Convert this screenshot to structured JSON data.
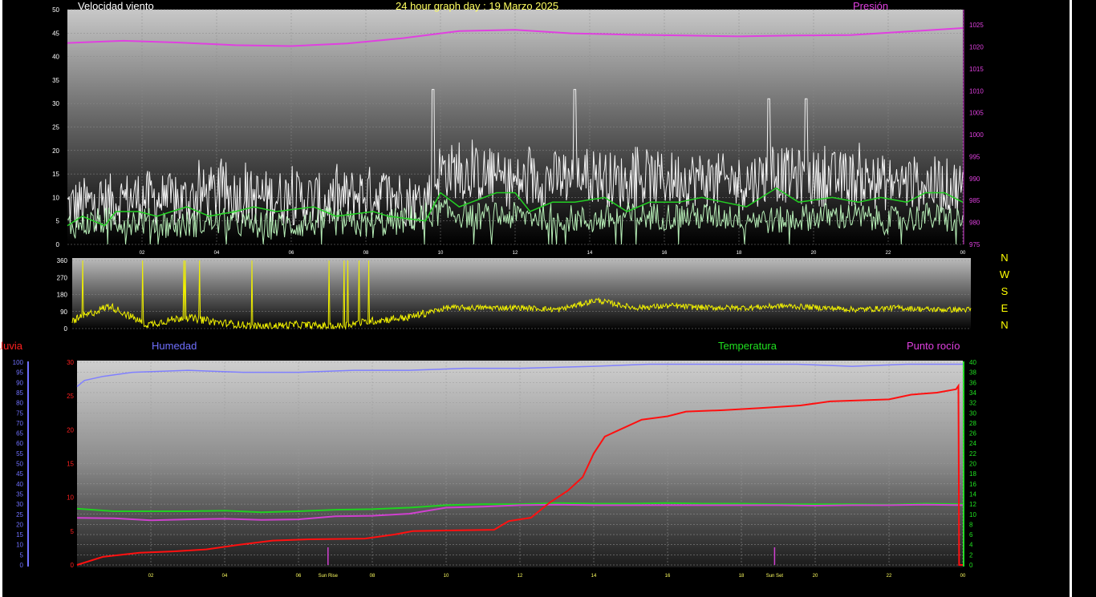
{
  "title": "24 hour graph day : 19 Marzo 2025",
  "colors": {
    "wind": "#f2f2f2",
    "wind_avg": "#b8f0b8",
    "wind_green": "#22d022",
    "pressure": "#e040e0",
    "direction": "#f0f000",
    "humidity": "#8080ff",
    "rain": "#ff1010",
    "temperature": "#20d020",
    "dew": "#d040d0",
    "rain_label": "#ff2020",
    "humidity_label": "#7070ff",
    "temperature_label": "#20e020",
    "dew_label": "#e040e0",
    "pressure_label": "#e040e0",
    "wind_label": "#ffffff",
    "title": "#ffff60"
  },
  "chart_data": [
    {
      "type": "line",
      "id": "wind-pressure",
      "title": "",
      "series_labels": {
        "wind": "Velocidad viento",
        "pressure": "Presión"
      },
      "x_ticks": [
        "02",
        "04",
        "06",
        "08",
        "",
        "10",
        "12",
        "14",
        "16",
        "18",
        "20",
        "22",
        "00"
      ],
      "x_range": [
        0,
        24
      ],
      "y_left": {
        "range": [
          0,
          50
        ],
        "ticks": [
          0,
          5,
          10,
          15,
          20,
          25,
          30,
          35,
          40,
          45,
          50
        ]
      },
      "y_right": {
        "range": [
          975,
          1028.5
        ],
        "ticks": [
          975,
          980,
          985,
          990,
          995,
          1000,
          1005,
          1010,
          1015,
          1020,
          1025
        ]
      },
      "grid": true,
      "series": [
        {
          "key": "pressure",
          "axis": "right",
          "x": [
            0,
            1.5,
            3,
            4.5,
            6,
            7.5,
            9,
            10.5,
            12,
            13.5,
            15,
            16.5,
            18,
            19.5,
            21,
            22.5,
            24
          ],
          "y": [
            1020.9,
            1021.4,
            1021.0,
            1020.4,
            1020.2,
            1020.8,
            1022.0,
            1023.6,
            1023.9,
            1023.1,
            1022.8,
            1022.6,
            1022.4,
            1022.6,
            1022.7,
            1023.5,
            1024.3
          ]
        },
        {
          "key": "wind",
          "axis": "left",
          "x": [
            0,
            1,
            2,
            3,
            4,
            5,
            6,
            7,
            8,
            9,
            9.5,
            10,
            11,
            12,
            13,
            14,
            15,
            16,
            17,
            18,
            19,
            20,
            21,
            22,
            23,
            24
          ],
          "y": [
            8,
            9,
            10,
            9,
            11,
            10,
            10,
            9,
            11,
            10,
            8,
            16,
            15,
            13,
            14,
            15,
            13,
            14,
            14,
            13,
            15,
            14,
            14,
            13,
            13,
            12
          ],
          "peaks": [
            {
              "x": 9.8,
              "y": 33
            },
            {
              "x": 13.6,
              "y": 33
            },
            {
              "x": 18.8,
              "y": 31
            },
            {
              "x": 19.8,
              "y": 31
            }
          ]
        },
        {
          "key": "wind_avg",
          "axis": "left",
          "x": [
            0,
            1,
            2,
            3,
            4,
            5,
            6,
            7,
            8,
            9,
            10,
            11,
            12,
            13,
            14,
            15,
            16,
            17,
            18,
            19,
            20,
            21,
            22,
            23,
            24
          ],
          "y": [
            4,
            5,
            5,
            4,
            5,
            4,
            4,
            5,
            4,
            5,
            7,
            6,
            6,
            6,
            5,
            6,
            6,
            6,
            6,
            5,
            6,
            6,
            5,
            6,
            5
          ]
        },
        {
          "key": "wind_green",
          "axis": "left",
          "x": [
            0,
            0.4,
            1,
            1.3,
            1.9,
            2.4,
            3.2,
            3.8,
            4.5,
            5,
            5.6,
            6.6,
            7.2,
            8.2,
            8.6,
            9.6,
            10,
            10.5,
            11.5,
            12,
            12.4,
            13,
            13.6,
            14.4,
            15,
            15.6,
            16.4,
            17,
            17.6,
            18.2,
            19,
            19.6,
            20.5,
            21.2,
            21.8,
            22.5,
            23,
            23.5,
            24
          ],
          "y": [
            4,
            6,
            4,
            7,
            7,
            6,
            8,
            6,
            7,
            8,
            7,
            8,
            6,
            7,
            6,
            5,
            11,
            8,
            11,
            11,
            7,
            9,
            9,
            10,
            7,
            9,
            9,
            10,
            9,
            8,
            12,
            9,
            10,
            9,
            10,
            9,
            11,
            11,
            9
          ]
        }
      ]
    },
    {
      "type": "line",
      "id": "wind-direction",
      "title": "",
      "x_range": [
        0,
        24
      ],
      "y_left": {
        "range": [
          0,
          360
        ],
        "ticks": [
          0,
          90,
          180,
          270,
          360
        ]
      },
      "compass_labels": [
        "N",
        "W",
        "S",
        "E",
        "N"
      ],
      "grid": true,
      "series": [
        {
          "key": "direction",
          "x": [
            0,
            1,
            2,
            3,
            4,
            5,
            6,
            7,
            8,
            9,
            9.4,
            10,
            11,
            12,
            13,
            14,
            15,
            16,
            17,
            18,
            19,
            20,
            21,
            22,
            23,
            24
          ],
          "y": [
            40,
            120,
            20,
            60,
            30,
            10,
            20,
            10,
            40,
            60,
            80,
            110,
            110,
            110,
            100,
            150,
            110,
            120,
            110,
            110,
            120,
            110,
            100,
            110,
            100,
            100
          ],
          "spikes_until_hour": 9.5
        }
      ]
    },
    {
      "type": "line",
      "id": "rain-humidity-temperature",
      "title": "",
      "series_labels": {
        "rain": "Lluvia",
        "humidity": "Humedad",
        "temperature": "Temperatura",
        "dew": "Punto rocío"
      },
      "x_ticks": [
        "02",
        "04",
        "06",
        "Sun Rise",
        "08",
        "10",
        "12",
        "14",
        "16",
        "18",
        "Sun Set",
        "20",
        "22",
        "00"
      ],
      "x_range": [
        0,
        24
      ],
      "sun_events": [
        {
          "label": "Sun Rise",
          "x": 6.8
        },
        {
          "label": "Sun Set",
          "x": 18.9
        }
      ],
      "y_far_left": {
        "range": [
          0,
          100
        ],
        "ticks": [
          0,
          5,
          10,
          15,
          20,
          25,
          30,
          35,
          40,
          45,
          50,
          55,
          60,
          65,
          70,
          75,
          80,
          85,
          90,
          95,
          100
        ]
      },
      "y_left": {
        "range": [
          0,
          30
        ],
        "ticks": [
          0,
          5,
          10,
          15,
          20,
          25,
          30
        ]
      },
      "y_right": {
        "range": [
          0,
          40
        ],
        "ticks": [
          0,
          2,
          4,
          6,
          8,
          10,
          12,
          14,
          16,
          18,
          20,
          22,
          24,
          26,
          28,
          30,
          32,
          34,
          36,
          38,
          40
        ]
      },
      "grid": true,
      "series": [
        {
          "key": "humidity",
          "axis": "far_left",
          "x": [
            0,
            0.2,
            0.7,
            1.5,
            3,
            4.5,
            6,
            7.5,
            9,
            10.5,
            12,
            14,
            15.5,
            17,
            19.5,
            21,
            22.5,
            24
          ],
          "y": [
            88,
            91,
            93,
            95,
            96,
            95,
            95,
            96,
            96,
            97,
            97,
            98,
            99,
            99,
            99,
            98,
            99,
            99
          ]
        },
        {
          "key": "rain",
          "axis": "left",
          "x": [
            0,
            0.7,
            1.7,
            2.6,
            3.5,
            4.4,
            5.3,
            6.3,
            7.8,
            8.6,
            9.1,
            10,
            11.3,
            11.7,
            12.3,
            12.8,
            13.3,
            13.7,
            14,
            14.3,
            14.7,
            15.3,
            16,
            16.5,
            17.5,
            18.5,
            19.6,
            20.4,
            22,
            22.6,
            23.3,
            23.82,
            23.88,
            23.9,
            24
          ],
          "y": [
            0,
            1.2,
            1.8,
            2.0,
            2.3,
            3.0,
            3.6,
            3.8,
            3.9,
            4.5,
            5.0,
            5.1,
            5.2,
            6.5,
            7.0,
            9.2,
            11.0,
            13.0,
            16.5,
            19.0,
            20.0,
            21.5,
            22.0,
            22.7,
            22.9,
            23.2,
            23.6,
            24.2,
            24.5,
            25.2,
            25.5,
            26.0,
            26.5,
            0,
            0
          ]
        },
        {
          "key": "temperature",
          "axis": "right",
          "x": [
            0,
            1,
            2,
            3,
            4,
            5,
            6,
            7,
            8,
            9,
            10,
            11,
            12,
            13,
            14,
            15,
            16,
            17,
            18,
            19,
            20,
            21,
            22,
            23,
            24
          ],
          "y": [
            11.1,
            10.6,
            10.6,
            10.6,
            10.7,
            10.4,
            10.6,
            10.9,
            11.0,
            11.3,
            11.8,
            12.0,
            12.0,
            12.2,
            12.1,
            12.1,
            12.2,
            12.1,
            12.1,
            12.0,
            12.0,
            12.0,
            11.9,
            12.1,
            12.0
          ]
        },
        {
          "key": "dew",
          "axis": "right",
          "x": [
            0,
            1,
            2,
            3,
            4,
            5,
            6,
            7,
            8,
            9,
            10,
            11,
            12,
            13,
            14,
            15,
            16,
            17,
            18,
            19,
            20,
            21,
            22,
            23,
            24
          ],
          "y": [
            9.3,
            9.2,
            8.8,
            9.0,
            9.1,
            8.9,
            9.0,
            9.6,
            9.7,
            10.1,
            11.3,
            11.5,
            11.8,
            11.9,
            11.8,
            11.8,
            11.8,
            11.8,
            11.8,
            11.8,
            11.7,
            11.8,
            11.8,
            11.9,
            11.8
          ]
        }
      ]
    }
  ]
}
